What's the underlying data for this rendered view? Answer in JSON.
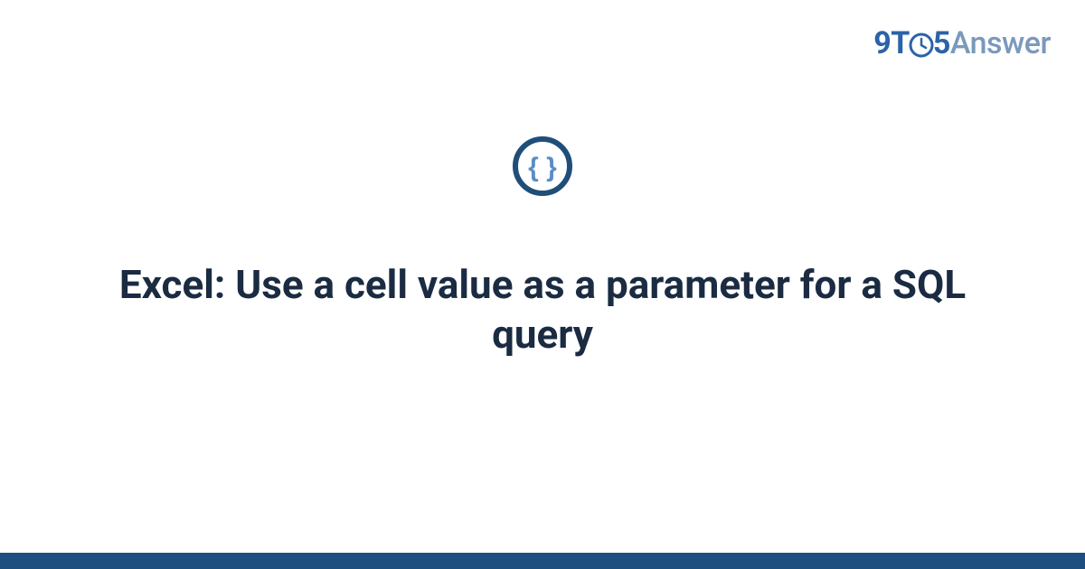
{
  "logo": {
    "prefix": "9T",
    "middle_digit": "5",
    "suffix": "Answer"
  },
  "title": "Excel: Use a cell value as a parameter for a SQL query",
  "colors": {
    "dark_blue": "#1d4e7f",
    "logo_blue": "#2a63a8",
    "light_blue": "#7a99bc",
    "icon_stroke": "#1f4e79",
    "icon_inner": "#5b8dc7",
    "text": "#1a2b42"
  }
}
